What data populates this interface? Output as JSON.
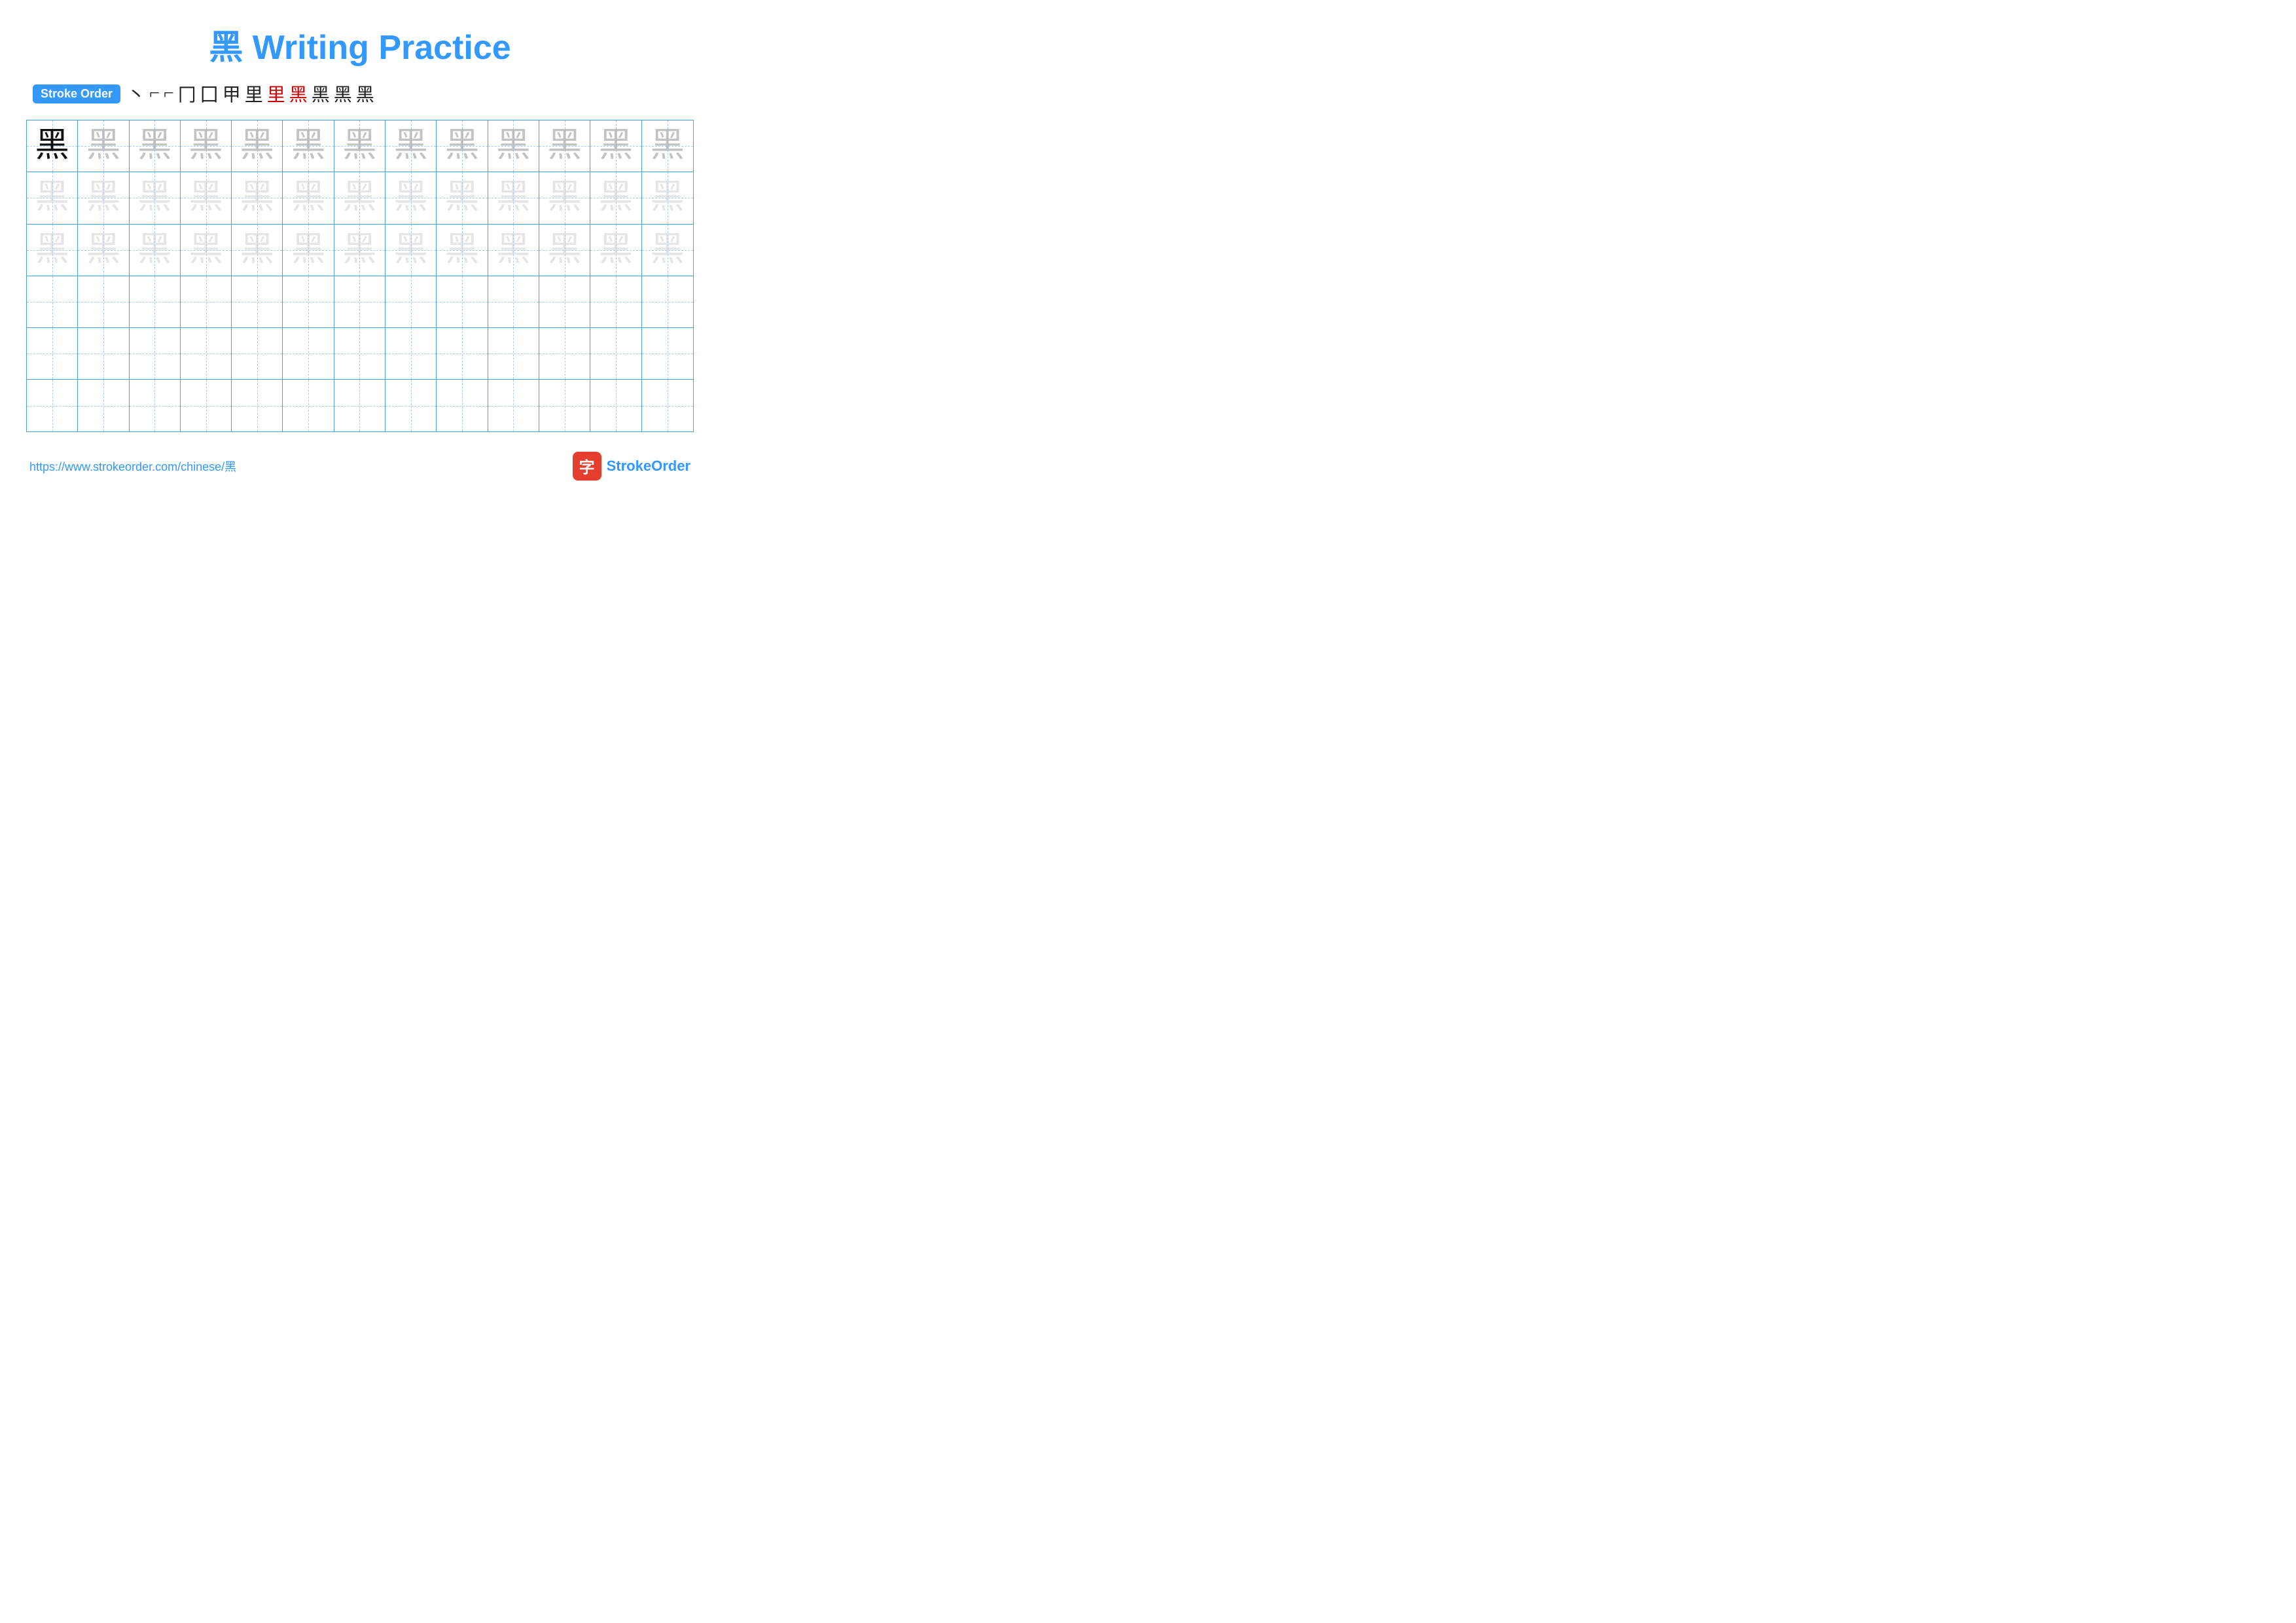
{
  "title": {
    "character": "黑",
    "text": "Writing Practice",
    "full": "黑 Writing Practice"
  },
  "stroke_order": {
    "badge_label": "Stroke Order",
    "strokes": [
      "丶",
      "⌐",
      "⌐",
      "冂",
      "囗",
      "甲",
      "里",
      "里",
      "黑",
      "黑",
      "黑",
      "黑"
    ],
    "red_mark_index": 8
  },
  "grid": {
    "cols": 13,
    "rows": 6,
    "character": "黑",
    "filled_rows": 3,
    "empty_rows": 3,
    "row_data": [
      {
        "type": "dark-then-medium",
        "dark_count": 1,
        "rest_shade": "medium-gray"
      },
      {
        "type": "all-light"
      },
      {
        "type": "all-lighter"
      },
      {
        "type": "empty"
      },
      {
        "type": "empty"
      },
      {
        "type": "empty"
      }
    ]
  },
  "footer": {
    "url": "https://www.strokeorder.com/chinese/黑",
    "logo_label": "字",
    "logo_text_1": "Stroke",
    "logo_text_2": "Order"
  }
}
